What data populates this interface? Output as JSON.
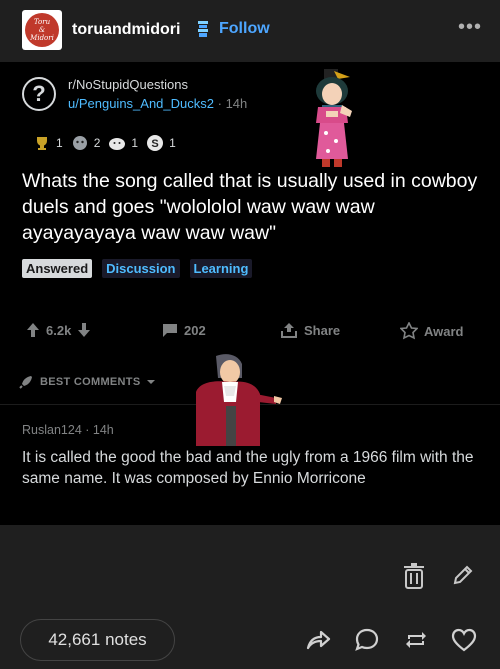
{
  "header": {
    "avatar_text": [
      "Toru",
      "&",
      "Midori"
    ],
    "blog_name": "toruandmidori",
    "follow_label": "Follow",
    "more_icon": "ellipsis-icon"
  },
  "reddit": {
    "subreddit": "r/NoStupidQuestions",
    "username": "u/Penguins_And_Ducks2",
    "time": "· 14h",
    "awards": [
      {
        "icon": "trophy-award-icon",
        "count": "1",
        "color": "#c9a227"
      },
      {
        "icon": "face-award-icon",
        "count": "2",
        "color": "#9aa0a6"
      },
      {
        "icon": "smile-award-icon",
        "count": "1",
        "color": "#e8e8e8"
      },
      {
        "icon": "coin-award-icon",
        "count": "1",
        "color": "#e8e8e8"
      }
    ],
    "title": "Whats the song called that is usually used in cowboy duels and goes \"wolololol waw waw waw ayayayayaya waw waw waw\"",
    "flairs": [
      "Answered",
      "Discussion",
      "Learning"
    ],
    "upvotes": "6.2k",
    "comments": "202",
    "share_label": "Share",
    "award_label": "Award",
    "sort_label": "BEST COMMENTS",
    "comment": {
      "author": "Ruslan124",
      "time": "· 14h",
      "text": "It is called the good the bad and the ugly from a 1966 film with the same name. It was composed by Ennio Morricone"
    }
  },
  "footer": {
    "notes": "42,661 notes"
  },
  "colors": {
    "follow": "#4da6ff",
    "reddit_link": "#4fbcff",
    "background": "#1f1f1f"
  }
}
